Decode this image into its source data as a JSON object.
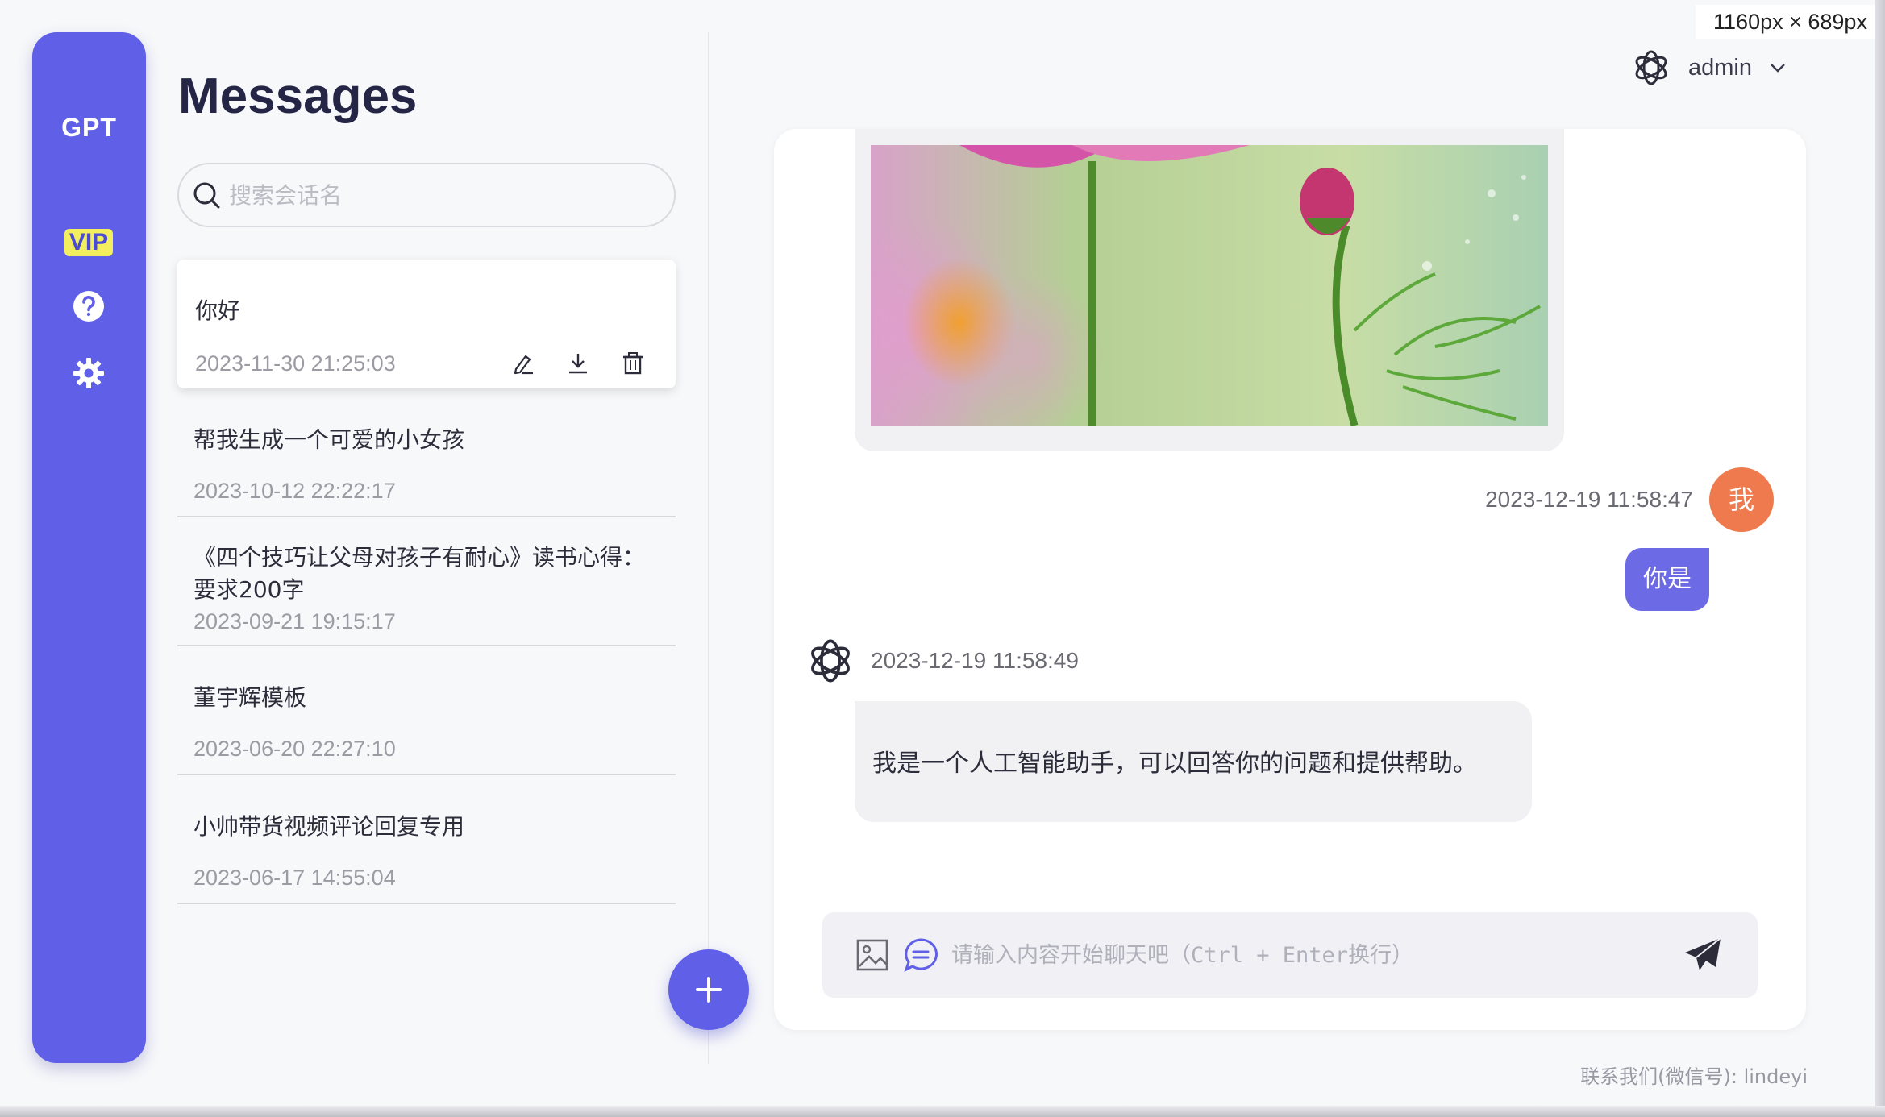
{
  "viewport_label": "1160px × 689px",
  "rail": {
    "logo": "GPT",
    "vip": "VIP",
    "help_icon": "question-circle-icon",
    "settings_icon": "gear-icon"
  },
  "messages": {
    "title": "Messages",
    "search_placeholder": "搜索会话名",
    "conversations": [
      {
        "title": "你好",
        "time": "2023-11-30 21:25:03",
        "active": true
      },
      {
        "title": "帮我生成一个可爱的小女孩",
        "time": "2023-10-12 22:22:17"
      },
      {
        "title": "《四个技巧让父母对孩子有耐心》读书心得：要求200字",
        "time": "2023-09-21 19:15:17"
      },
      {
        "title": "董宇辉模板",
        "time": "2023-06-20 22:27:10"
      },
      {
        "title": "小帅带货视频评论回复专用",
        "time": "2023-06-17 14:55:04"
      }
    ],
    "new_button_label": "+"
  },
  "header": {
    "user_name": "admin"
  },
  "chat": {
    "my_time": "2023-12-19 11:58:47",
    "my_avatar": "我",
    "my_message": "你是",
    "bot_time": "2023-12-19 11:58:49",
    "bot_message": "我是一个人工智能助手，可以回答你的问题和提供帮助。",
    "composer_placeholder": "请输入内容开始聊天吧（Ctrl + Enter换行）"
  },
  "footer": "联系我们(微信号): lindeyi",
  "colors": {
    "accent": "#5f5fe7",
    "user_avatar": "#ef7a4d",
    "user_bubble": "#6d6ae6",
    "vip_badge": "#f3ee5e"
  }
}
